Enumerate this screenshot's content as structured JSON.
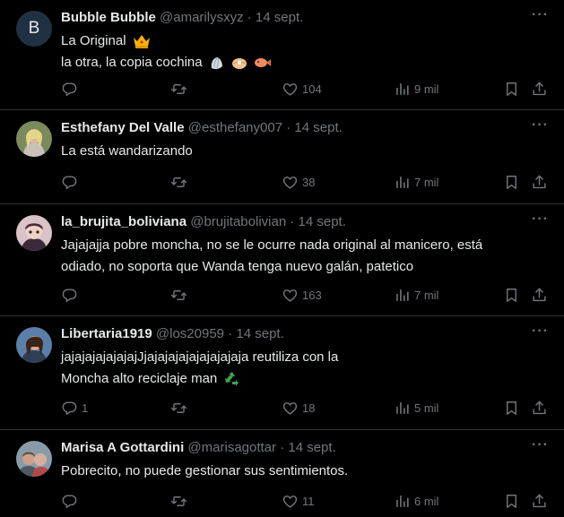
{
  "tweets": [
    {
      "name": "Bubble Bubble",
      "handle": "@amarilysxyz",
      "sep": "·",
      "date": "14 sept.",
      "avatar_letter": "B",
      "lines": [
        "La Original",
        "la otra, la copia cochina"
      ],
      "emojis": [
        "crown-emoji",
        "shell-emoji",
        "oyster-emoji",
        "fish-emoji"
      ],
      "replies": "",
      "likes": "104",
      "views": "9 mil"
    },
    {
      "name": "Esthefany Del Valle",
      "handle": "@esthefany007",
      "sep": "·",
      "date": "14 sept.",
      "lines": [
        "La está wandarizando"
      ],
      "replies": "",
      "likes": "38",
      "views": "7 mil"
    },
    {
      "name": "la_brujita_boliviana",
      "handle": "@brujitabolivian",
      "sep": "·",
      "date": "14 sept.",
      "lines": [
        "Jajajajja pobre moncha, no se le ocurre nada original al manicero, está",
        "odiado, no soporta que Wanda tenga nuevo galán, patetico"
      ],
      "replies": "",
      "likes": "163",
      "views": "7 mil"
    },
    {
      "name": "Libertaria1919",
      "handle": "@los20959",
      "sep": "·",
      "date": "14 sept.",
      "lines": [
        "jajajajajajajajJjajajajajajajajajaja reutiliza con la",
        "Moncha alto reciclaje man"
      ],
      "emojis": [
        "recycle-emoji"
      ],
      "replies": "1",
      "likes": "18",
      "views": "5 mil"
    },
    {
      "name": "Marisa A Gottardini",
      "handle": "@marisagottar",
      "sep": "·",
      "date": "14 sept.",
      "lines": [
        "Pobrecito, no puede gestionar sus sentimientos."
      ],
      "replies": "",
      "likes": "11",
      "views": "6 mil"
    }
  ],
  "more_glyph": "···",
  "colors": {
    "background": "#000000",
    "text": "#e7e9ea",
    "muted": "#71767b",
    "divider": "#2f3336"
  }
}
